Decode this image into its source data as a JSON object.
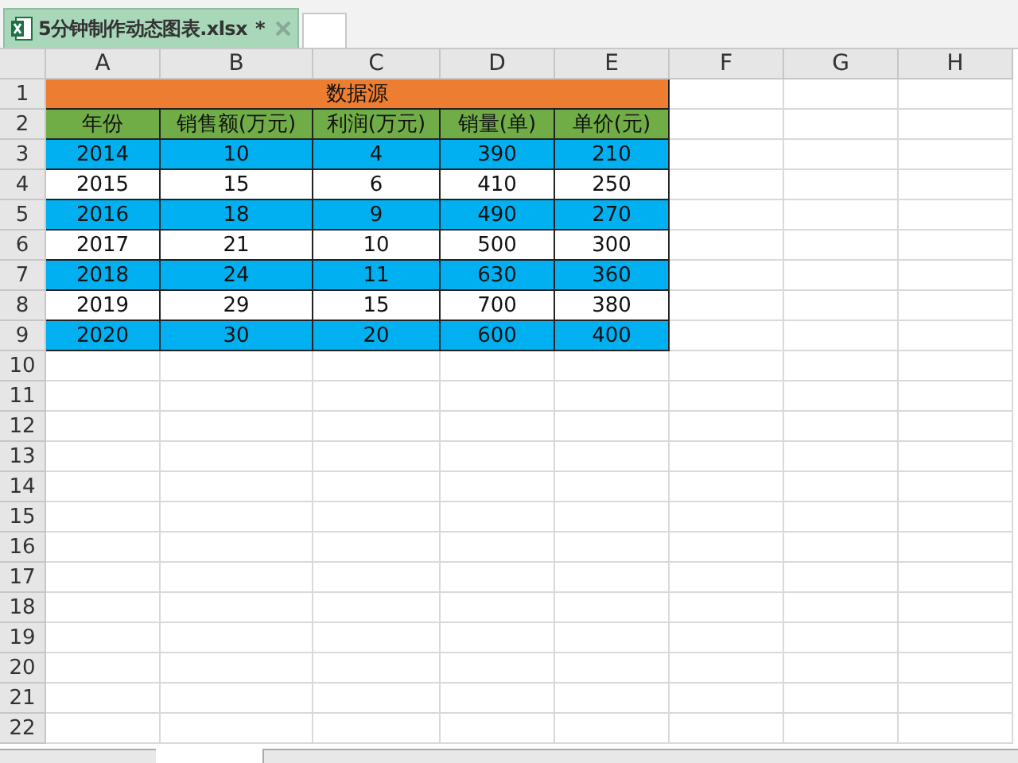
{
  "file_tab": {
    "title": "5分钟制作动态图表.xlsx",
    "modified_mark": "*"
  },
  "column_headers": [
    "A",
    "B",
    "C",
    "D",
    "E",
    "F",
    "G",
    "H"
  ],
  "rows": [
    {
      "number": "1",
      "kind": "title",
      "cells": [
        "数据源"
      ]
    },
    {
      "number": "2",
      "kind": "header",
      "cells": [
        "年份",
        "销售额(万元)",
        "利润(万元)",
        "销量(单)",
        "单价(元)"
      ]
    },
    {
      "number": "3",
      "kind": "band",
      "cells": [
        "2014",
        "10",
        "4",
        "390",
        "210"
      ]
    },
    {
      "number": "4",
      "kind": "plain",
      "cells": [
        "2015",
        "15",
        "6",
        "410",
        "250"
      ]
    },
    {
      "number": "5",
      "kind": "band",
      "cells": [
        "2016",
        "18",
        "9",
        "490",
        "270"
      ]
    },
    {
      "number": "6",
      "kind": "plain",
      "cells": [
        "2017",
        "21",
        "10",
        "500",
        "300"
      ]
    },
    {
      "number": "7",
      "kind": "band",
      "cells": [
        "2018",
        "24",
        "11",
        "630",
        "360"
      ]
    },
    {
      "number": "8",
      "kind": "plain",
      "cells": [
        "2019",
        "29",
        "15",
        "700",
        "380"
      ]
    },
    {
      "number": "9",
      "kind": "band",
      "cells": [
        "2020",
        "30",
        "20",
        "600",
        "400"
      ]
    },
    {
      "number": "10",
      "kind": "empty"
    },
    {
      "number": "11",
      "kind": "empty"
    },
    {
      "number": "12",
      "kind": "empty"
    },
    {
      "number": "13",
      "kind": "empty"
    },
    {
      "number": "14",
      "kind": "empty"
    },
    {
      "number": "15",
      "kind": "empty"
    },
    {
      "number": "16",
      "kind": "empty"
    },
    {
      "number": "17",
      "kind": "empty"
    },
    {
      "number": "18",
      "kind": "empty"
    },
    {
      "number": "19",
      "kind": "empty"
    },
    {
      "number": "20",
      "kind": "empty"
    },
    {
      "number": "21",
      "kind": "empty"
    },
    {
      "number": "22",
      "kind": "empty"
    }
  ]
}
